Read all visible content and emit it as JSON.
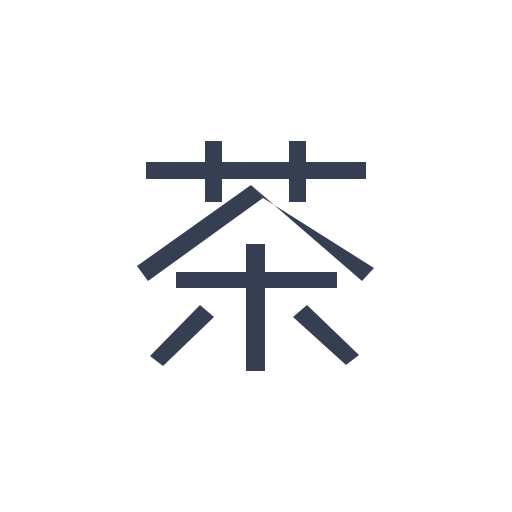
{
  "character": "茶",
  "colors": {
    "background": "#ffffff",
    "ink": "#363f51"
  }
}
